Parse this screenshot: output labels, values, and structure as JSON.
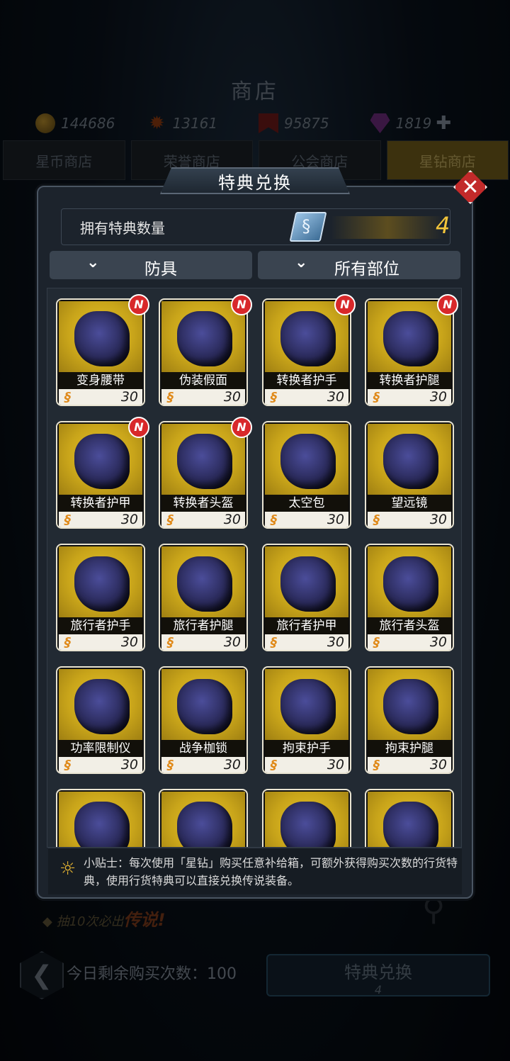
{
  "shop": {
    "title": "商店",
    "currencies": [
      {
        "icon": "gold-coin-icon",
        "value": "144686"
      },
      {
        "icon": "gear-token-icon",
        "value": "13161"
      },
      {
        "icon": "ribbon-badge-icon",
        "value": "95875"
      },
      {
        "icon": "diamond-gem-icon",
        "value": "1819"
      }
    ],
    "tabs": [
      "星币商店",
      "荣誉商店",
      "公会商店",
      "星钻商店"
    ],
    "active_tab": "星钻商店",
    "hint_prefix": "抽10次必出",
    "hint_emph": "传说!",
    "remaining_label": "今日剩余购买次数：100",
    "redeem_button": "特典兑换",
    "redeem_count": "4"
  },
  "modal": {
    "title": "特典兑换",
    "own_label": "拥有特典数量",
    "own_count": "4",
    "filter_type": "防具",
    "filter_part": "所有部位",
    "items": [
      {
        "name": "变身腰带",
        "price": "30",
        "new": true
      },
      {
        "name": "伪装假面",
        "price": "30",
        "new": true
      },
      {
        "name": "转换者护手",
        "price": "30",
        "new": true
      },
      {
        "name": "转换者护腿",
        "price": "30",
        "new": true
      },
      {
        "name": "转换者护甲",
        "price": "30",
        "new": true
      },
      {
        "name": "转换者头盔",
        "price": "30",
        "new": true
      },
      {
        "name": "太空包",
        "price": "30",
        "new": false
      },
      {
        "name": "望远镜",
        "price": "30",
        "new": false
      },
      {
        "name": "旅行者护手",
        "price": "30",
        "new": false
      },
      {
        "name": "旅行者护腿",
        "price": "30",
        "new": false
      },
      {
        "name": "旅行者护甲",
        "price": "30",
        "new": false
      },
      {
        "name": "旅行者头盔",
        "price": "30",
        "new": false
      },
      {
        "name": "功率限制仪",
        "price": "30",
        "new": false
      },
      {
        "name": "战争枷锁",
        "price": "30",
        "new": false
      },
      {
        "name": "拘束护手",
        "price": "30",
        "new": false
      },
      {
        "name": "拘束护腿",
        "price": "30",
        "new": false
      },
      {
        "name": "",
        "price": "",
        "new": false
      },
      {
        "name": "",
        "price": "",
        "new": false
      },
      {
        "name": "",
        "price": "",
        "new": false
      },
      {
        "name": "",
        "price": "",
        "new": false
      }
    ],
    "new_badge": "N",
    "tip": "小贴士：每次使用「星钻」购买任意补给箱，可额外获得购买次数的行货特典，使用行货特典可以直接兑换传说装备。"
  },
  "colors": {
    "gold_card": "#e6c32b",
    "accent_yellow": "#f2c43a",
    "close_red": "#c22a2a",
    "new_badge_red": "#d8282a"
  }
}
